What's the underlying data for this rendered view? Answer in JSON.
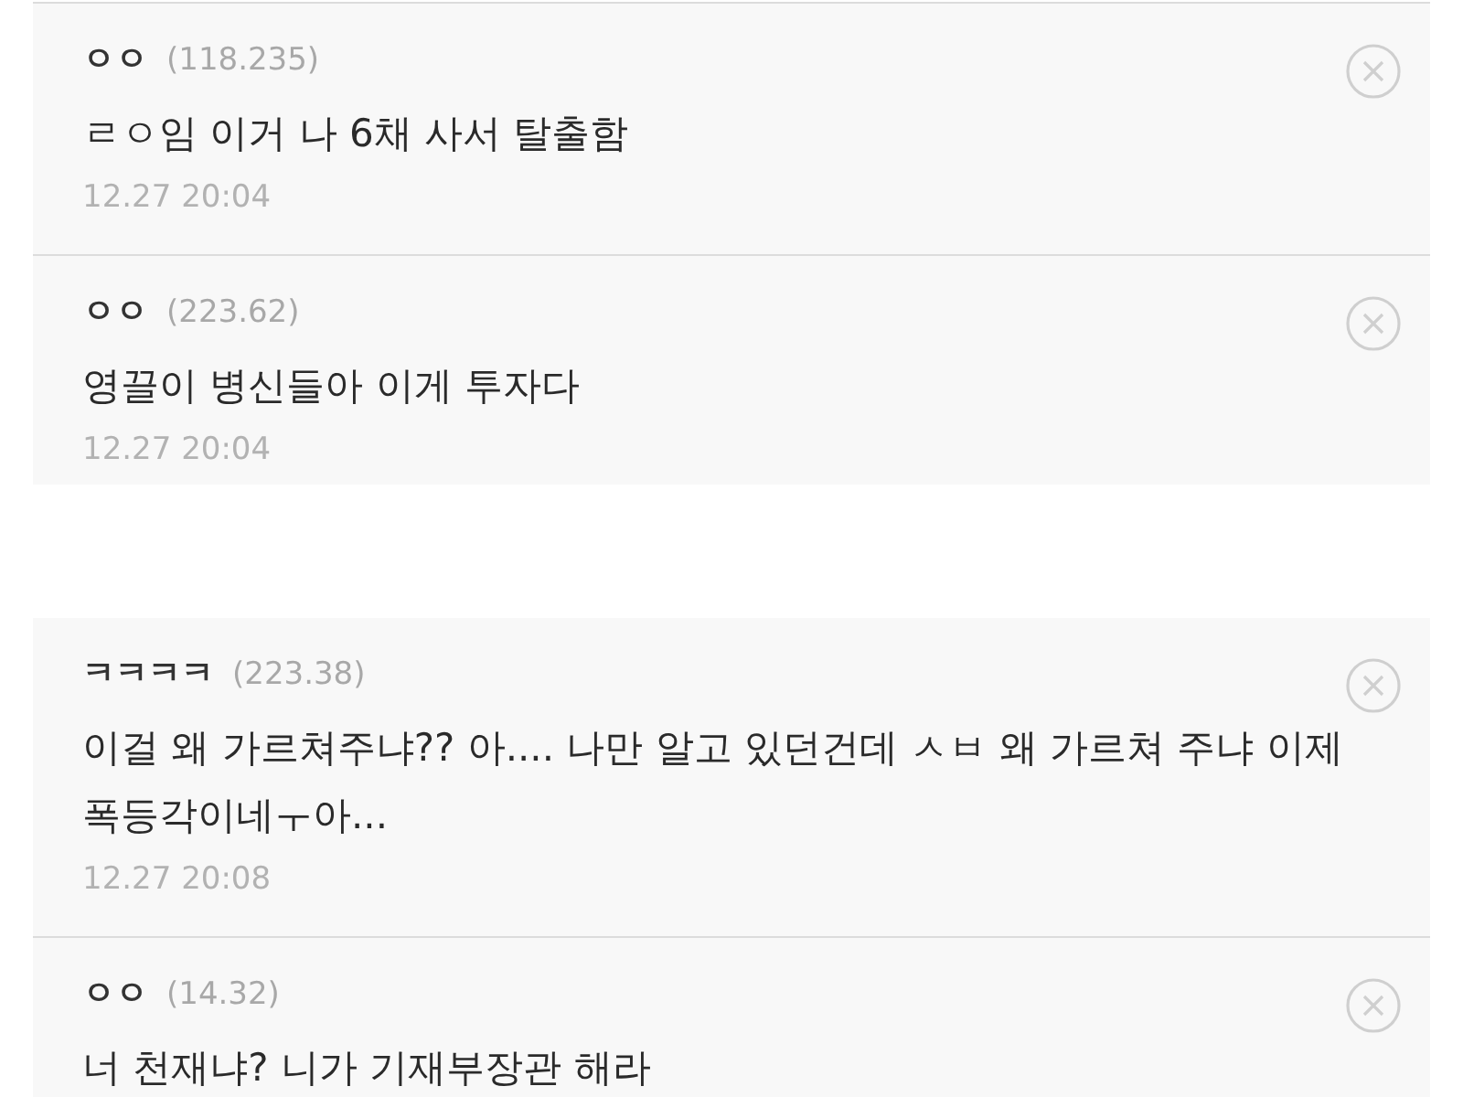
{
  "sections": [
    {
      "comments": [
        {
          "author": "ㅇㅇ",
          "ip": "(118.235)",
          "content": "ㄹㅇ임 이거 나 6채 사서 탈출함",
          "date": "12.27 20:04"
        },
        {
          "author": "ㅇㅇ",
          "ip": "(223.62)",
          "content": "영끌이 병신들아 이게 투자다",
          "date": "12.27 20:04"
        }
      ]
    },
    {
      "comments": [
        {
          "author": "ㅋㅋㅋㅋ",
          "ip": "(223.38)",
          "content": "이걸 왜 가르쳐주냐?? 아.... 나만 알고 있던건데 ㅅㅂ 왜 가르쳐 주냐 이제 폭등각이네ㅜ아...",
          "date": "12.27 20:08"
        },
        {
          "author": "ㅇㅇ",
          "ip": "(14.32)",
          "content": "너 천재냐? 니가 기재부장관 해라"
        }
      ]
    }
  ]
}
